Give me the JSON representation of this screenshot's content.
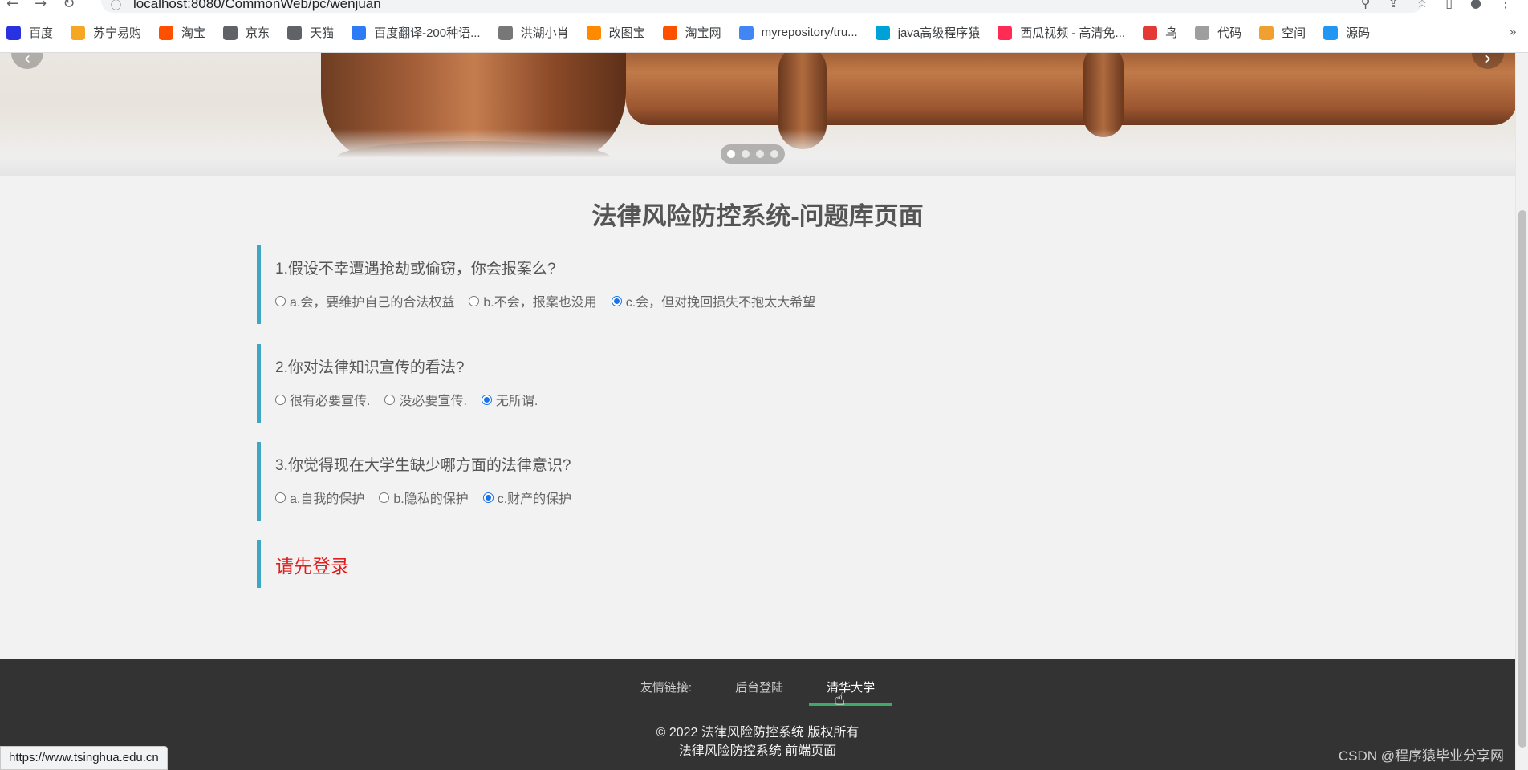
{
  "browser": {
    "url": "localhost:8080/CommonWeb/pc/wenjuan",
    "bookmarks": [
      {
        "label": "百度",
        "color": "#2932e1"
      },
      {
        "label": "苏宁易购",
        "color": "#f5a623"
      },
      {
        "label": "淘宝",
        "color": "#ff5000"
      },
      {
        "label": "京东",
        "color": "#5f6368"
      },
      {
        "label": "天猫",
        "color": "#5f6368"
      },
      {
        "label": "百度翻译-200种语...",
        "color": "#2d7cf5"
      },
      {
        "label": "洪湖小肖",
        "color": "#777777"
      },
      {
        "label": "改图宝",
        "color": "#ff8a00"
      },
      {
        "label": "淘宝网",
        "color": "#ff5000"
      },
      {
        "label": "myrepository/tru...",
        "color": "#4285f4"
      },
      {
        "label": "java高级程序猿",
        "color": "#00a1d6"
      },
      {
        "label": "西瓜视频 - 高清免...",
        "color": "#fe2c55"
      },
      {
        "label": "鸟",
        "color": "#e53935"
      },
      {
        "label": "代码",
        "color": "#9e9e9e"
      },
      {
        "label": "空间",
        "color": "#f0a030"
      },
      {
        "label": "源码",
        "color": "#2196f3"
      }
    ],
    "more": "»",
    "status_url": "https://www.tsinghua.edu.cn"
  },
  "carousel": {
    "dots": 4,
    "active": 0
  },
  "page": {
    "title": "法律风险防控系统-问题库页面"
  },
  "questions": [
    {
      "text": "1.假设不幸遭遇抢劫或偷窃，你会报案么?",
      "options": [
        "a.会，要维护自己的合法权益",
        "b.不会，报案也没用",
        "c.会，但对挽回损失不抱太大希望"
      ],
      "selected": 2
    },
    {
      "text": "2.你对法律知识宣传的看法?",
      "options": [
        "很有必要宣传.",
        "没必要宣传.",
        "无所谓."
      ],
      "selected": 2
    },
    {
      "text": "3.你觉得现在大学生缺少哪方面的法律意识?",
      "options": [
        "a.自我的保护",
        "b.隐私的保护",
        "c.财产的保护"
      ],
      "selected": 2
    }
  ],
  "login_prompt": "请先登录",
  "footer": {
    "links_label": "友情链接:",
    "links": [
      "后台登陆",
      "清华大学"
    ],
    "active_link": 1,
    "copyright": "© 2022 法律风险防控系统 版权所有",
    "subtitle": "法律风险防控系统 前端页面",
    "watermark": "CSDN @程序猿毕业分享网"
  }
}
